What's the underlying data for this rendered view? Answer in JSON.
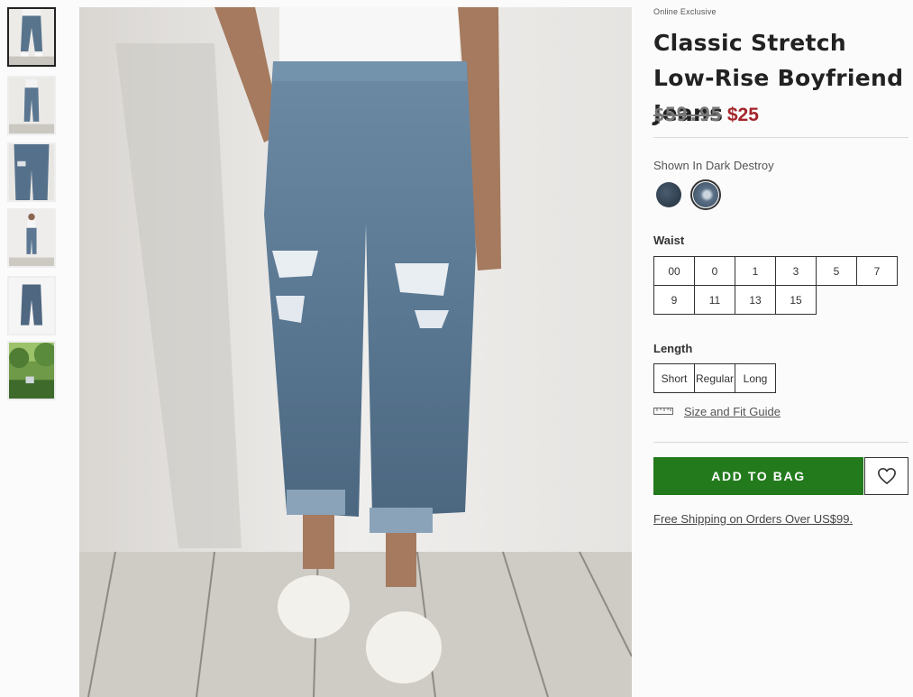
{
  "gallery": {
    "thumbnails": [
      {
        "name": "front-full",
        "active": true
      },
      {
        "name": "side-view",
        "active": false
      },
      {
        "name": "back-detail",
        "active": false
      },
      {
        "name": "model-full",
        "active": false
      },
      {
        "name": "flat-lay",
        "active": false
      },
      {
        "name": "outdoor-scene",
        "active": false
      }
    ]
  },
  "product": {
    "badge": "Online Exclusive",
    "title": "Classic Stretch Low-Rise Boyfriend Jeans",
    "price_original": "$59.95",
    "price_sale": "$25",
    "swatch_label": "Shown In Dark Destroy",
    "swatches": [
      {
        "name": "dark-wash",
        "color": "#2c3a4a",
        "selected": false
      },
      {
        "name": "dark-destroy",
        "color": "#4e6277",
        "selected": true
      }
    ]
  },
  "waist": {
    "label": "Waist",
    "sizes": [
      "00",
      "0",
      "1",
      "3",
      "5",
      "7",
      "9",
      "11",
      "13",
      "15"
    ]
  },
  "length": {
    "label": "Length",
    "options": [
      "Short",
      "Regular",
      "Long"
    ]
  },
  "guide": {
    "icon": "ruler-icon",
    "label": "Size and Fit Guide"
  },
  "actions": {
    "add_to_bag": "ADD TO BAG",
    "wishlist_icon": "heart-icon",
    "accent_color": "#237a1d"
  },
  "shipping": {
    "text": "Free Shipping on Orders Over US$99."
  },
  "colors": {
    "sale_price": "#a4252b"
  }
}
